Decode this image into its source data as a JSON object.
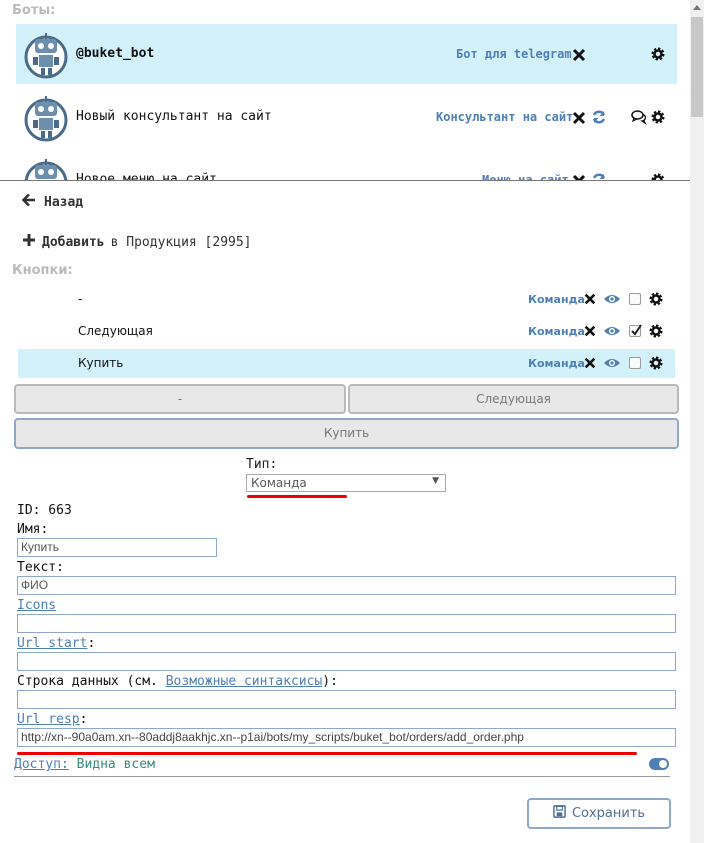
{
  "bots": {
    "heading": "Боты:",
    "items": [
      {
        "name": "@buket_bot",
        "type": "Бот для telegram",
        "selected": true,
        "icons": [
          "delete-icon",
          "settings-icon"
        ]
      },
      {
        "name": "Новый консультант на сайт",
        "type": "Консультант на сайт",
        "selected": false,
        "icons": [
          "delete-icon",
          "refresh-icon",
          "chat-icon",
          "settings-icon"
        ]
      },
      {
        "name": "Новое меню на сайт",
        "type": "Меню на сайт",
        "selected": false,
        "icons": [
          "delete-icon",
          "refresh-icon",
          "settings-icon"
        ]
      }
    ]
  },
  "nav": {
    "back_label": "Назад",
    "add_label": "Добавить",
    "add_context": "в Продукция [2995]"
  },
  "buttons_section": {
    "heading": "Кнопки:",
    "items": [
      {
        "label": "-",
        "type": "Команда",
        "checked": false,
        "selected": false
      },
      {
        "label": "Следующая",
        "type": "Команда",
        "checked": true,
        "selected": false
      },
      {
        "label": "Купить",
        "type": "Команда",
        "checked": false,
        "selected": true
      }
    ]
  },
  "preview": {
    "row1": [
      "-",
      "Следующая"
    ],
    "row2": [
      "Купить"
    ]
  },
  "form": {
    "type_label": "Тип:",
    "type_value": "Команда",
    "id_text": "ID: 663",
    "name_label": "Имя:",
    "name_value": "Купить",
    "text_label": "Текст:",
    "text_value": "ФИО",
    "icons_link": "Icons",
    "icons_value": "",
    "url_start_link": "Url start",
    "url_start_colon": ":",
    "url_start_value": "",
    "data_label_prefix": "Строка данных (см. ",
    "data_label_link": "Возможные синтаксисы",
    "data_label_suffix": "):",
    "data_value": "",
    "url_resp_link": "Url resp",
    "url_resp_colon": ":",
    "url_resp_value": "http://xn--90a0am.xn--80addj8aakhjc.xn--p1ai/bots/my_scripts/buket_bot/orders/add_order.php",
    "access_link": "Доступ:",
    "access_value": "Видна всем",
    "save_label": "Сохранить"
  },
  "colors": {
    "selected_row": "#d3f1fa",
    "link": "#4f7fb4",
    "highlight": "#ee0000"
  }
}
